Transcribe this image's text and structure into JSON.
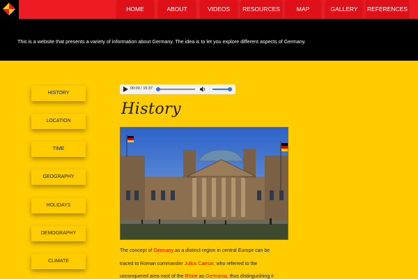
{
  "nav": {
    "items": [
      {
        "label": "HOME"
      },
      {
        "label": "ABOUT"
      },
      {
        "label": "VIDEOS"
      },
      {
        "label": "RESOURCES"
      },
      {
        "label": "MAP"
      },
      {
        "label": "GALLERY"
      },
      {
        "label": "REFERENCES"
      }
    ]
  },
  "intro": {
    "text": "This is a website that presents a variety of information about Germany. The idea is to let you explore different aspects of Germany."
  },
  "sidebar": {
    "items": [
      {
        "label": "HISTORY"
      },
      {
        "label": "LOCATION"
      },
      {
        "label": "TIME"
      },
      {
        "label": "GEOGRAPHY"
      },
      {
        "label": "HOLIDAYS"
      },
      {
        "label": "DEMOGRAPHY"
      },
      {
        "label": "CLIMATE"
      }
    ]
  },
  "audio": {
    "time": "00:00 / 15:37",
    "play_icon": "play-icon",
    "volume_icon": "volume-icon",
    "progress": 0.0,
    "volume": 1.0
  },
  "main": {
    "heading": "History",
    "image_alt": "Reichstag building",
    "para": {
      "l1a": "The concept of ",
      "l1b": "Germany",
      "l1c": " as a distinct region in central Europe can be",
      "l2a": "traced to Roman commander ",
      "l2b": "Julius Caesar",
      "l2c": ", who referred to the",
      "l3a": "unconquered area east of the ",
      "l3b": "Rhine",
      "l3c": " as ",
      "l3d": "Germania",
      "l3e": ", thus distinguishing it"
    }
  },
  "colors": {
    "topbar": "#ed1c24",
    "band": "#000000",
    "background": "#ffcc00",
    "link": "#e60000"
  }
}
